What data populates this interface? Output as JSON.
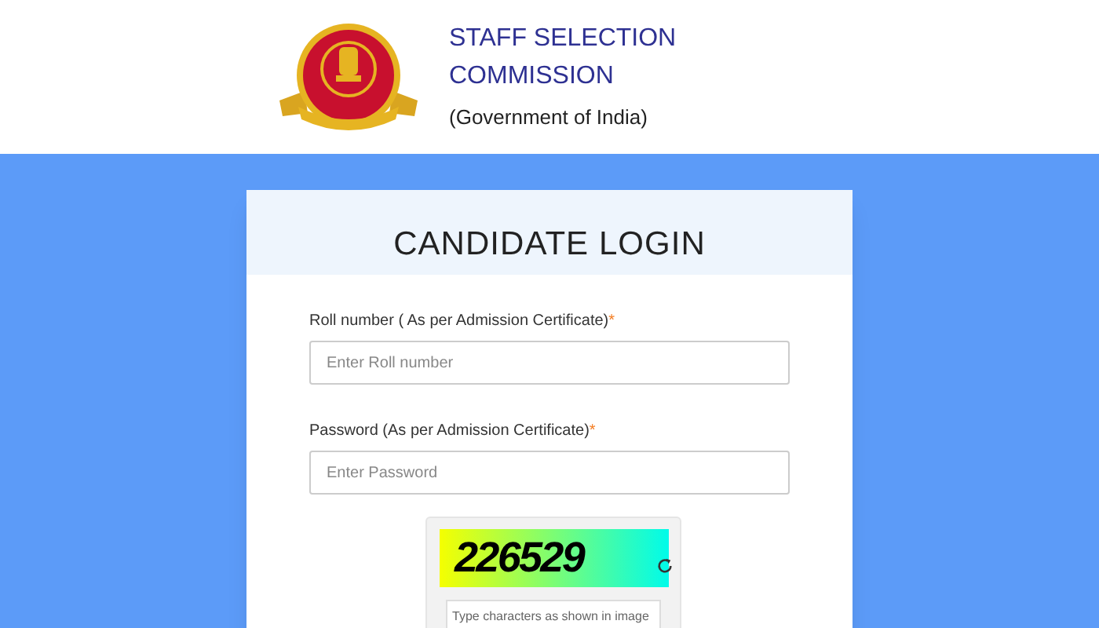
{
  "header": {
    "title": "STAFF SELECTION COMMISSION",
    "subtitle": "(Government of India)"
  },
  "login": {
    "title": "CANDIDATE LOGIN",
    "fields": [
      {
        "label": "Roll number ( As per Admission Certificate)",
        "required_mark": "*",
        "placeholder": "Enter Roll number"
      },
      {
        "label": "Password (As per Admission Certificate)",
        "required_mark": "*",
        "placeholder": "Enter Password"
      }
    ],
    "captcha": {
      "code": "226529",
      "placeholder": "Type characters as shown in image"
    }
  }
}
